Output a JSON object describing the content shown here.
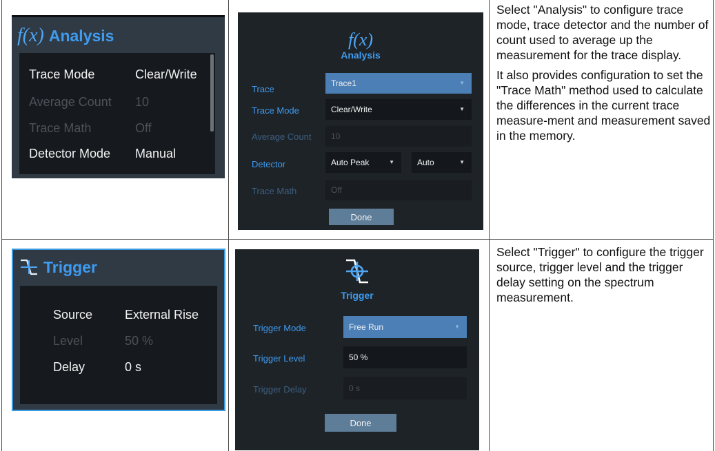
{
  "analysis": {
    "tile": {
      "icon": "fx-icon",
      "title": "Analysis",
      "rows": [
        {
          "label": "Trace Mode",
          "value": "Clear/Write"
        },
        {
          "label": "Average Count",
          "value": "10"
        },
        {
          "label": "Trace Math",
          "value": "Off"
        },
        {
          "label": "Detector Mode",
          "value": "Manual"
        }
      ]
    },
    "dialog": {
      "icon": "fx-icon",
      "title": "Analysis",
      "trace_label": "Trace",
      "trace_value": "Trace1",
      "trace_mode_label": "Trace Mode",
      "trace_mode_value": "Clear/Write",
      "average_count_label": "Average Count",
      "average_count_value": "10",
      "detector_label": "Detector",
      "detector_value": "Auto Peak",
      "detector_mode_value": "Auto",
      "trace_math_label": "Trace Math",
      "trace_math_value": "Off",
      "done_label": "Done"
    },
    "description": [
      "Select \"Analysis\" to configure trace mode, trace detector and the number of count used to average up the measurement for the trace display.",
      "It also provides configuration to set the \"Trace Math\" method used to calculate the differences in the current trace measure-ment and measurement saved in the memory."
    ]
  },
  "trigger": {
    "tile": {
      "icon": "trigger-icon",
      "title": "Trigger",
      "rows": [
        {
          "label": "Source",
          "value": "External Rise"
        },
        {
          "label": "Level",
          "value": "50 %"
        },
        {
          "label": "Delay",
          "value": "0 s"
        }
      ]
    },
    "dialog": {
      "icon": "trigger-icon",
      "title": "Trigger",
      "mode_label": "Trigger Mode",
      "mode_value": "Free Run",
      "level_label": "Trigger Level",
      "level_value": "50 %",
      "delay_label": "Trigger Delay",
      "delay_value": "0 s",
      "done_label": "Done"
    },
    "description": [
      "Select \"Trigger\" to configure the trigger source, trigger level and the trigger delay setting on the spectrum measurement."
    ]
  },
  "colors": {
    "accent": "#3f9bef",
    "tile_bg": "#2f3a44",
    "dialog_bg": "#1e2328",
    "selected_field": "#4b7fb6",
    "button": "#5e7d99",
    "tile_border_selected": "#3a9be0"
  }
}
